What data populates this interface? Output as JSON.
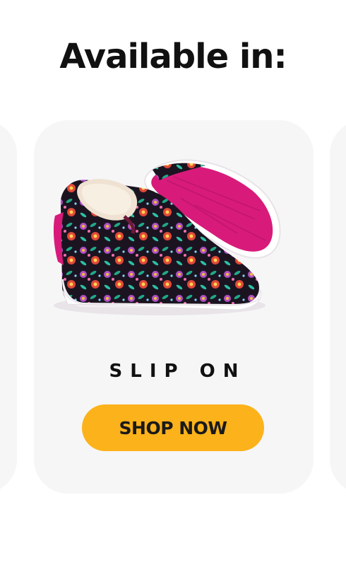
{
  "heading": "Available in:",
  "colors": {
    "card_background": "#f6f6f7",
    "button_background": "#fcb21a",
    "text": "#111111",
    "sole_magenta": "#d81b7a"
  },
  "card": {
    "title": "SLIP ON",
    "button_label": "SHOP NOW",
    "image_icon": "floral-slip-on-shoe-image"
  }
}
